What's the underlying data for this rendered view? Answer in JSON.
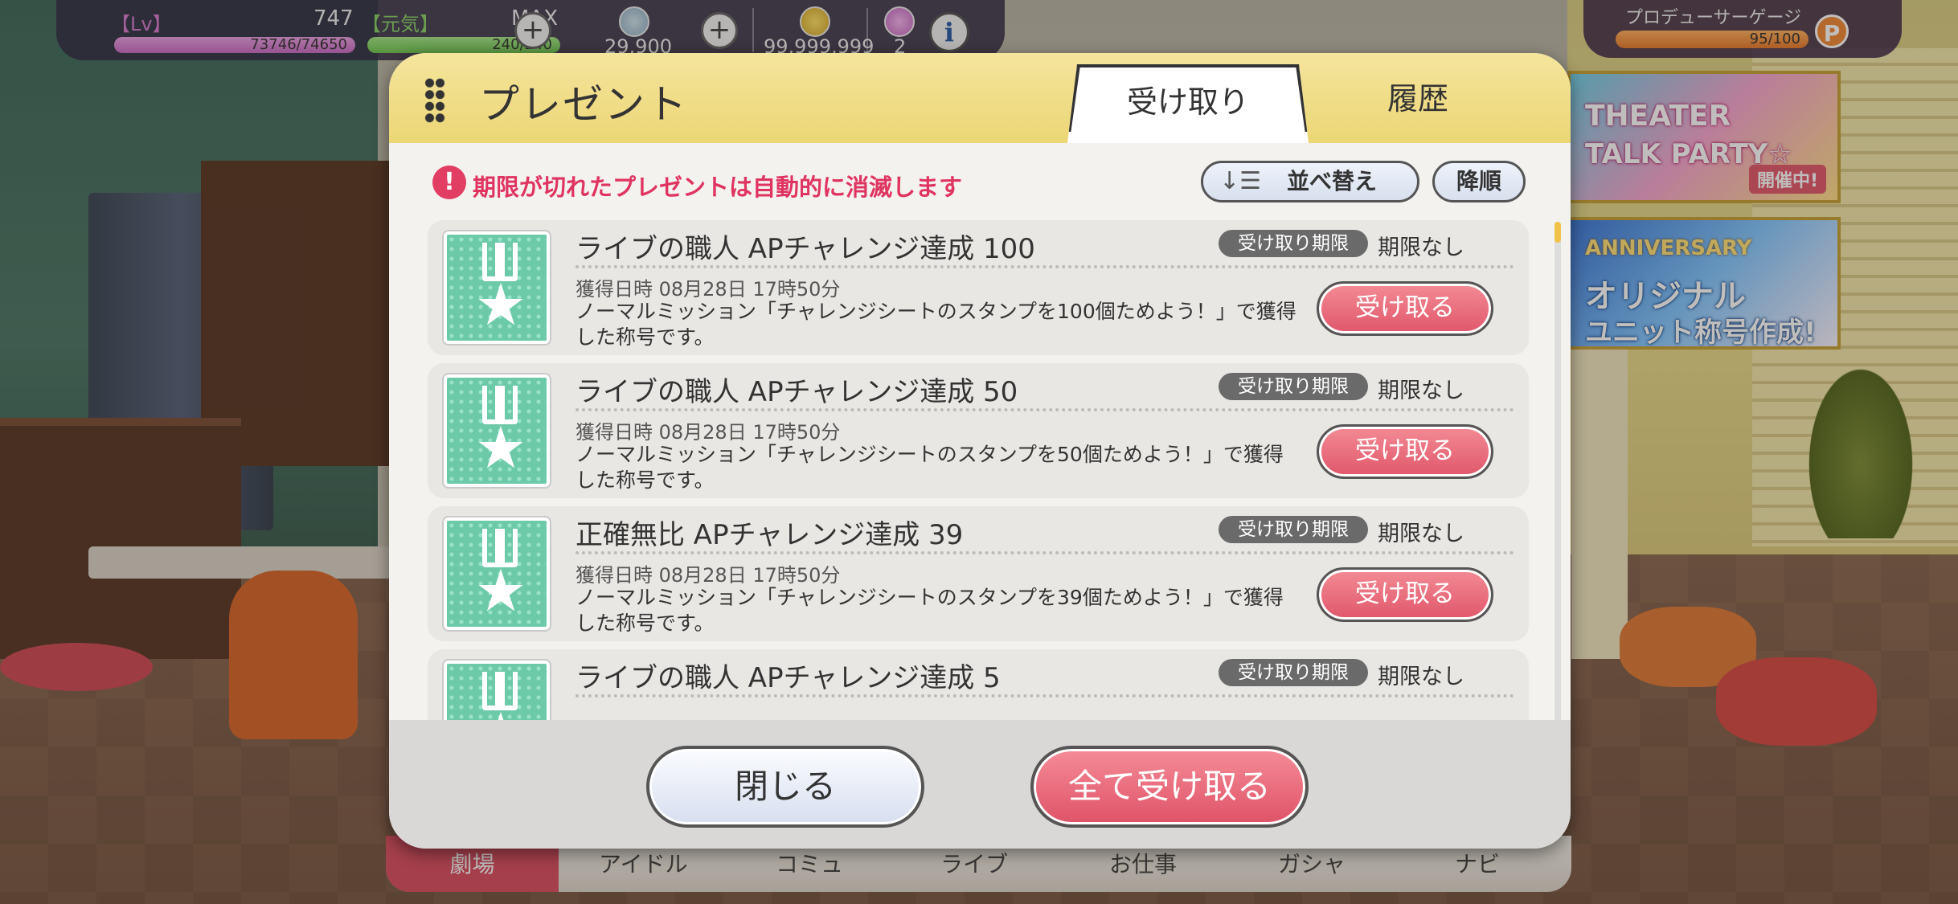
{
  "status_bar": {
    "lv_label": "【Lv】",
    "lv_value": "747",
    "stamina_label": "【元気】",
    "stamina_max": "MAX",
    "exp_text": "73746/74650",
    "stamina_text": "240/240",
    "gems": "29,900",
    "coins": "99,999,999",
    "tickets": "2",
    "info_label": "i",
    "plus_label": "+"
  },
  "producer_gauge": {
    "label": "プロデューサーゲージ",
    "value": "95/100",
    "icon_label": "P"
  },
  "banners": [
    {
      "line1": "THEATER",
      "line2": "TALK PARTY☆",
      "badge": "開催中!"
    },
    {
      "line1": "ANNIVERSARY",
      "line2": "オリジナル",
      "line3": "ユニット称号作成!"
    }
  ],
  "bottom_nav": [
    "劇場",
    "アイドル",
    "コミュ",
    "ライブ",
    "お仕事",
    "ガシャ",
    "ナビ"
  ],
  "dialog": {
    "title": "プレゼント",
    "tabs": {
      "receive": "受け取り",
      "history": "履歴"
    },
    "warning": "期限が切れたプレゼントは自動的に消滅します",
    "warning_icon": "!",
    "sort_icon": "↓☰",
    "sort_label": "並べ替え",
    "order_label": "降順",
    "items": [
      {
        "title": "ライブの職人 APチャレンジ達成 100",
        "deadline_label": "受け取り期限",
        "deadline_value": "期限なし",
        "date": "獲得日時 08月28日 17時50分",
        "desc": "ノーマルミッション「チャレンジシートのスタンプを100個ためよう！」で獲得した称号です。",
        "button": "受け取る"
      },
      {
        "title": "ライブの職人 APチャレンジ達成 50",
        "deadline_label": "受け取り期限",
        "deadline_value": "期限なし",
        "date": "獲得日時 08月28日 17時50分",
        "desc": "ノーマルミッション「チャレンジシートのスタンプを50個ためよう！」で獲得した称号です。",
        "button": "受け取る"
      },
      {
        "title": "正確無比 APチャレンジ達成 39",
        "deadline_label": "受け取り期限",
        "deadline_value": "期限なし",
        "date": "獲得日時 08月28日 17時50分",
        "desc": "ノーマルミッション「チャレンジシートのスタンプを39個ためよう！」で獲得した称号です。",
        "button": "受け取る"
      },
      {
        "title": "ライブの職人 APチャレンジ達成 5",
        "deadline_label": "受け取り期限",
        "deadline_value": "期限なし",
        "date": "",
        "desc": "",
        "button": ""
      }
    ],
    "close_label": "閉じる",
    "receive_all_label": "全て受け取る"
  },
  "colors": {
    "accent_pink": "#e0566b",
    "header_yellow": "#ecd675",
    "warning_red": "#e03460",
    "medal_green": "#6ccaa9"
  },
  "icons": [
    "grip-icon",
    "warning-icon",
    "sort-icon",
    "medal-icon",
    "star-icon",
    "gem-icon",
    "coin-icon",
    "ticket-icon",
    "info-icon",
    "plus-icon",
    "producer-p-icon"
  ]
}
